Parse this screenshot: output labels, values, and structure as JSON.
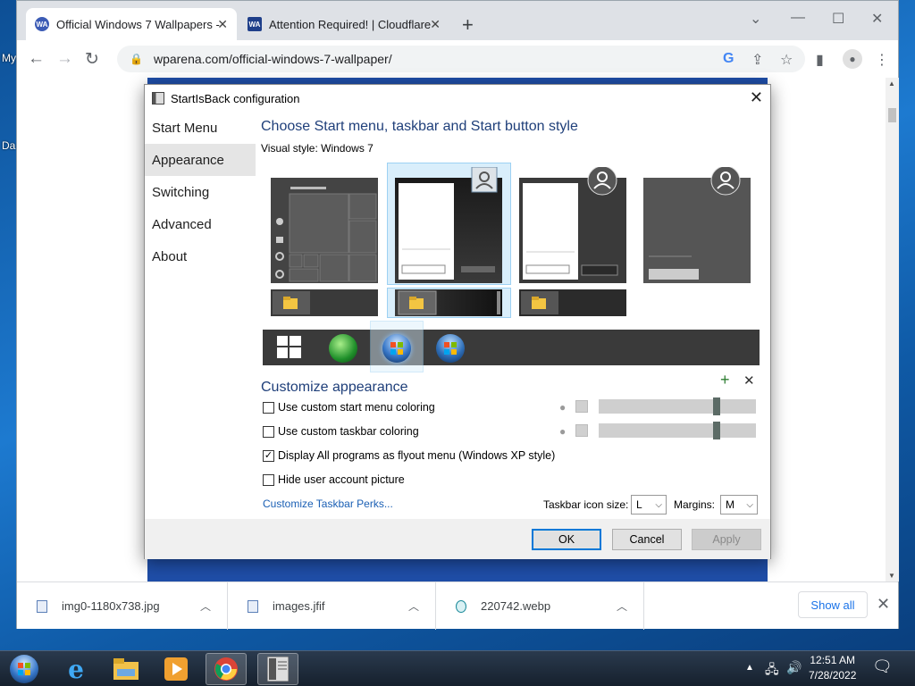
{
  "desktop": {
    "icon_labels": [
      "My",
      "Da"
    ]
  },
  "browser": {
    "tabs": [
      {
        "title": "Official Windows 7 Wallpapers -",
        "favicon": "wp-icon",
        "favicon_text": "WA"
      },
      {
        "title": "Attention Required! | Cloudflare",
        "favicon": "wa-icon",
        "favicon_text": "WA"
      }
    ],
    "new_tab": "+",
    "url": "wparena.com/official-windows-7-wallpaper/"
  },
  "downloads": {
    "items": [
      {
        "name": "img0-1180x738.jpg"
      },
      {
        "name": "images.jfif"
      },
      {
        "name": "220742.webp"
      }
    ],
    "show_all": "Show all"
  },
  "dialog": {
    "title": "StartIsBack configuration",
    "nav": [
      "Start Menu",
      "Appearance",
      "Switching",
      "Advanced",
      "About"
    ],
    "selected_nav": "Appearance",
    "heading": "Choose Start menu, taskbar and Start button style",
    "visual_style": "Visual style:  Windows 7",
    "customize_heading": "Customize appearance",
    "options": [
      {
        "label": "Use custom start menu coloring",
        "checked": false
      },
      {
        "label": "Use custom taskbar coloring",
        "checked": false
      },
      {
        "label": "Display All programs as flyout menu (Windows XP style)",
        "checked": true
      },
      {
        "label": "Hide user account picture",
        "checked": false
      }
    ],
    "perks_link": "Customize Taskbar Perks...",
    "icon_size_label": "Taskbar icon size:",
    "icon_size_value": "L",
    "margins_label": "Margins:",
    "margins_value": "M",
    "buttons": {
      "ok": "OK",
      "cancel": "Cancel",
      "apply": "Apply"
    }
  },
  "taskbar": {
    "time": "12:51 AM",
    "date": "7/28/2022"
  }
}
